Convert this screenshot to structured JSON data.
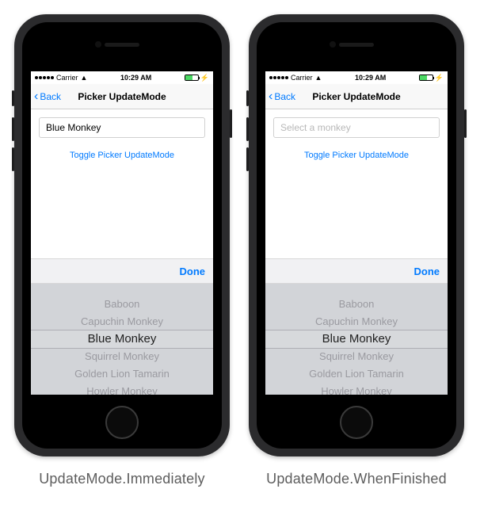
{
  "status": {
    "carrier": "Carrier",
    "time": "10:29 AM"
  },
  "nav": {
    "back": "Back",
    "title": "Picker UpdateMode"
  },
  "field_left": "Blue Monkey",
  "field_right_placeholder": "Select a monkey",
  "toggle": "Toggle Picker UpdateMode",
  "done": "Done",
  "picker": {
    "i0": "Baboon",
    "i1": "Capuchin Monkey",
    "i2": "Blue Monkey",
    "i3": "Squirrel Monkey",
    "i4": "Golden Lion Tamarin",
    "i5": "Howler Monkey"
  },
  "caption_left": "UpdateMode.Immediately",
  "caption_right": "UpdateMode.WhenFinished"
}
